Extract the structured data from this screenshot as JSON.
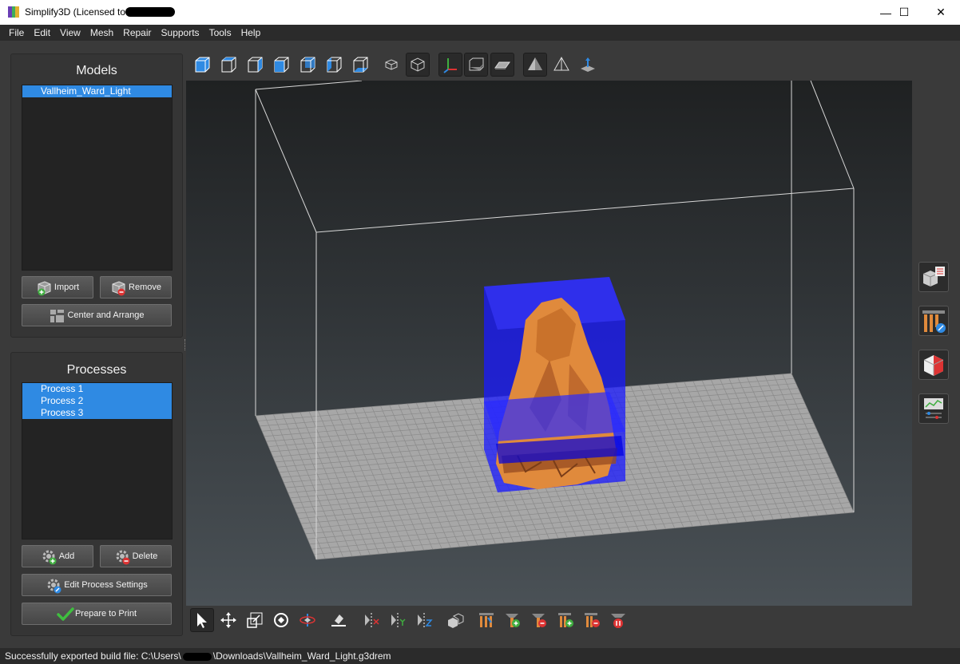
{
  "window": {
    "title": "Simplify3D (Licensed to",
    "minimize": "—",
    "maximize": "☐",
    "close": "✕"
  },
  "menu": [
    "File",
    "Edit",
    "View",
    "Mesh",
    "Repair",
    "Supports",
    "Tools",
    "Help"
  ],
  "models": {
    "title": "Models",
    "items": [
      "Vallheim_Ward_Light"
    ],
    "import_label": "Import",
    "remove_label": "Remove",
    "center_arrange_label": "Center and Arrange"
  },
  "processes": {
    "title": "Processes",
    "items": [
      "Process 1",
      "Process 2",
      "Process 3"
    ],
    "add_label": "Add",
    "delete_label": "Delete",
    "edit_label": "Edit Process Settings",
    "prepare_label": "Prepare to Print"
  },
  "status": {
    "prefix": "Successfully exported build file: C:\\Users\\",
    "suffix": "\\Downloads\\Vallheim_Ward_Light.g3drem"
  },
  "colors": {
    "accent": "#2f8ae3",
    "model": "#e08a3c",
    "support_box": "#1a1aff",
    "prepare_check": "#3fbf3f"
  },
  "icons": {
    "top_toolbar": [
      "view-default-icon",
      "view-top-icon",
      "view-bottom-icon",
      "view-front-icon",
      "view-back-icon",
      "view-left-icon",
      "view-right-icon",
      "perspective-icon",
      "orthographic-icon",
      "axes-icon",
      "build-volume-icon",
      "bed-icon",
      "shaded-icon",
      "wireframe-icon",
      "normals-icon"
    ],
    "bottom_toolbar": [
      "select-icon",
      "move-icon",
      "scale-icon",
      "rotate-icon",
      "rotate-axis-icon",
      "place-on-bed-icon",
      "mirror-x-icon",
      "mirror-y-icon",
      "mirror-z-icon",
      "duplicate-icon",
      "support-generate-icon",
      "support-add-icon",
      "support-remove-icon",
      "support-add-manual-icon",
      "support-remove-manual-icon",
      "support-delete-all-icon"
    ],
    "side": [
      "object-list-icon",
      "edit-supports-icon",
      "cross-section-icon",
      "print-stats-icon"
    ]
  }
}
